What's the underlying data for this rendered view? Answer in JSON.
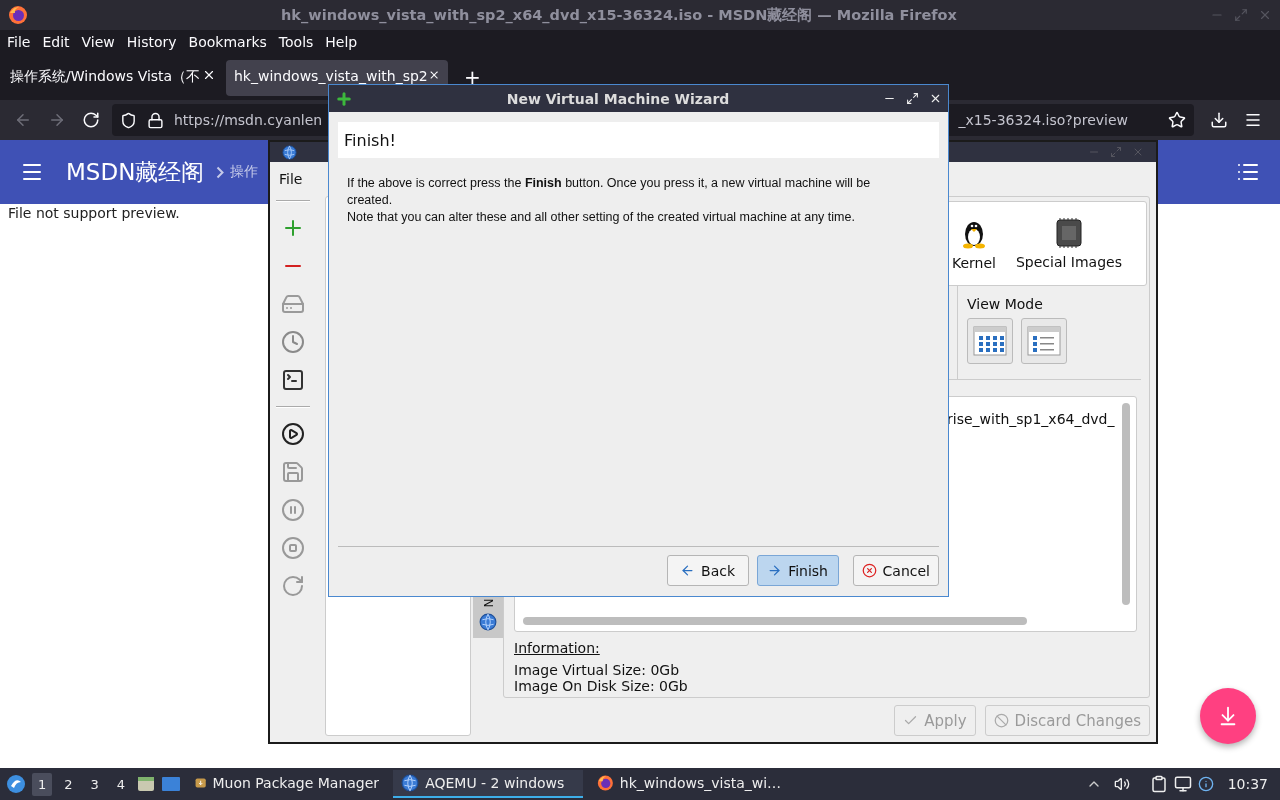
{
  "firefox": {
    "title": "hk_windows_vista_with_sp2_x64_dvd_x15-36324.iso - MSDN藏经阁 — Mozilla Firefox",
    "menu": [
      "File",
      "Edit",
      "View",
      "History",
      "Bookmarks",
      "Tools",
      "Help"
    ],
    "tabs": [
      {
        "label": "操作系统/Windows Vista（不",
        "selected": false
      },
      {
        "label": "hk_windows_vista_with_sp2",
        "selected": true
      }
    ],
    "new_tab": "+",
    "url": {
      "start": "https://msdn.cyanlen",
      "end": "_x15-36324.iso?preview"
    },
    "page": {
      "site_title": "MSDN藏经阁",
      "breadcrumb": "操作",
      "message": "File not support preview."
    }
  },
  "aqemu": {
    "menu": [
      "File"
    ],
    "categories": [
      {
        "label": "Kernel",
        "kind": "penguin"
      },
      {
        "label": "Special Images",
        "kind": "chip"
      }
    ],
    "view_mode": {
      "label": "View Mode",
      "modes": [
        {
          "kind": "grid"
        },
        {
          "kind": "list"
        }
      ]
    },
    "image_list": [
      "rise_with_sp1_x64_dvd_"
    ],
    "side_tab": "N",
    "information": {
      "heading": "Information:",
      "lines": [
        "Image Virtual Size: 0Gb",
        "Image On Disk Size: 0Gb"
      ]
    },
    "buttons": [
      {
        "label": "Apply",
        "kind": "apply",
        "disabled": true
      },
      {
        "label": "Discard Changes",
        "kind": "discard",
        "disabled": true
      }
    ]
  },
  "wizard": {
    "title": "New Virtual Machine Wizard",
    "heading": "Finish!",
    "text": [
      "If the above is correct press the **Finish** button. Once you press it, a new virtual machine will be created.",
      "Note that you can alter these and all other setting of the created virtual machine at any time."
    ],
    "buttons": [
      {
        "label": "Back",
        "kind": "back",
        "default": false
      },
      {
        "label": "Finish",
        "kind": "finish",
        "default": true
      },
      {
        "label": "Cancel",
        "kind": "cancel",
        "default": false
      }
    ]
  },
  "taskbar": {
    "workspaces": [
      {
        "label": "1",
        "selected": true
      },
      {
        "label": "2",
        "selected": false
      },
      {
        "label": "3",
        "selected": false
      },
      {
        "label": "4",
        "selected": false
      }
    ],
    "tasks": [
      {
        "label": "Muon Package Manager",
        "kind": "package",
        "selected": false
      },
      {
        "label": "AQEMU - 2 windows",
        "kind": "globe",
        "selected": true
      },
      {
        "label": "hk_windows_vista_wi…",
        "kind": "firefox",
        "selected": false
      }
    ],
    "clock": "10:37"
  }
}
